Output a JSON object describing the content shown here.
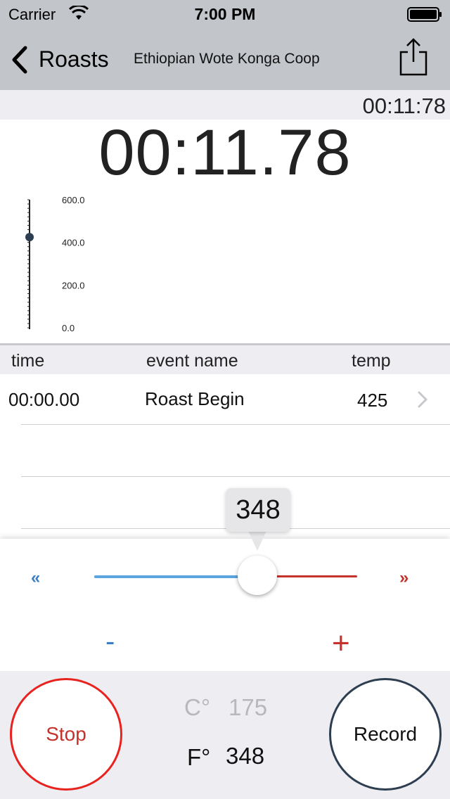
{
  "status_bar": {
    "carrier": "Carrier",
    "time": "7:00 PM",
    "icons": [
      "wifi-icon",
      "battery-icon"
    ]
  },
  "nav": {
    "back_label": "Roasts",
    "title": "Ethiopian Wote Konga Coop",
    "share_icon": "share-icon"
  },
  "timer": {
    "small": "00:11:78",
    "big": "00:11.78"
  },
  "chart_data": {
    "type": "line",
    "y_ticks": [
      "600.0",
      "400.0",
      "200.0",
      "0.0"
    ],
    "ylim": [
      0,
      600
    ],
    "points": [
      {
        "x": 0,
        "y": 425
      }
    ],
    "point_color": "#2c3e50"
  },
  "table": {
    "headers": {
      "time": "time",
      "event": "event name",
      "temp": "temp"
    },
    "rows": [
      {
        "time": "00:00.00",
        "event": "Roast Begin",
        "temp": "425"
      }
    ]
  },
  "slider": {
    "bubble_value": "348",
    "rewind_glyph": "«",
    "forward_glyph": "»",
    "minus": "-",
    "plus": "+",
    "level": 0.58,
    "colors": {
      "low": "#3a7fc4",
      "high": "#c4322b"
    }
  },
  "controls": {
    "stop_label": "Stop",
    "record_label": "Record",
    "celsius_unit": "C°",
    "celsius_value": "175",
    "fahrenheit_unit": "F°",
    "fahrenheit_value": "348"
  }
}
